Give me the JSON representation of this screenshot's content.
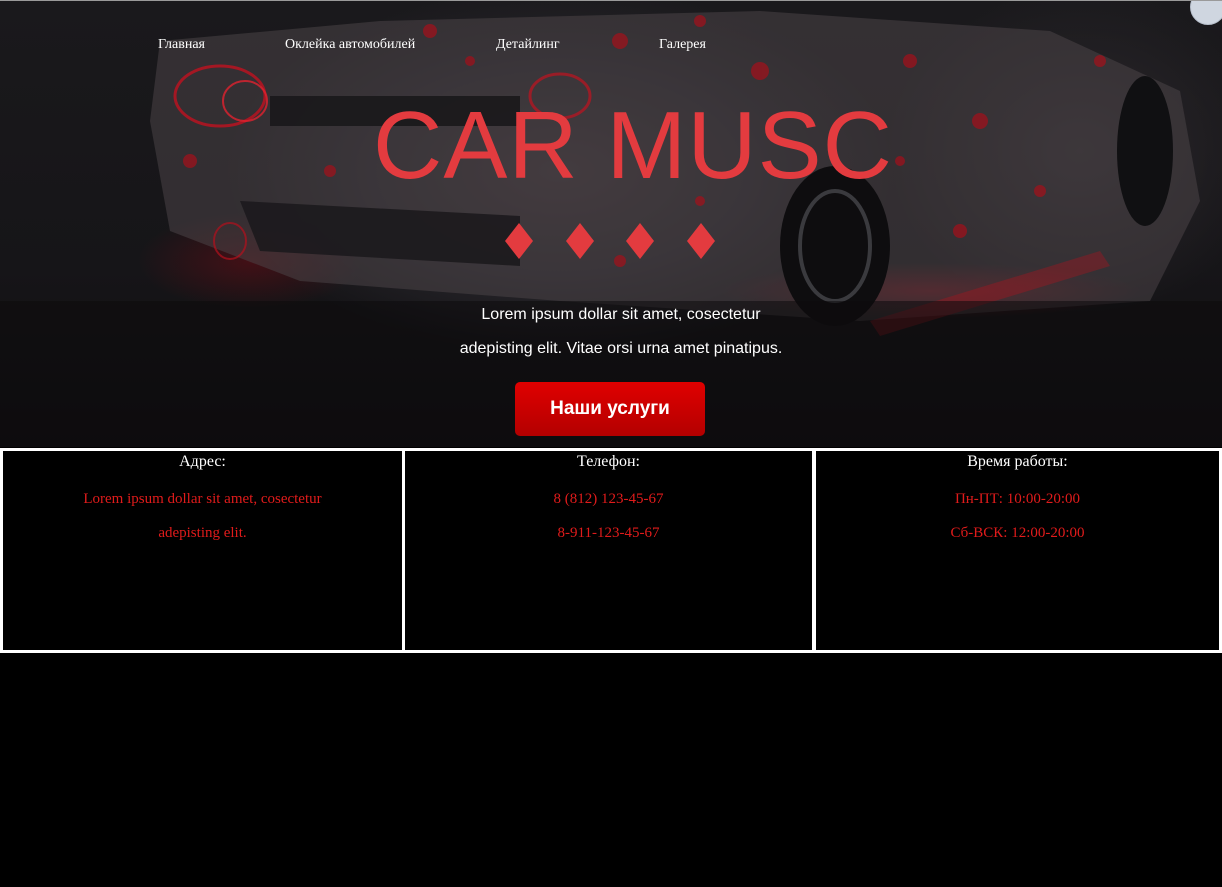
{
  "nav": {
    "items": [
      "Главная",
      "Оклейка автомобилей",
      "Детайлинг",
      "Галерея"
    ]
  },
  "hero": {
    "title": "CAR MUSC",
    "decor_symbol": "diamond",
    "decor_count": 4,
    "text_line1": "Lorem ipsum dollar sit amet, cosectetur",
    "text_line2": "adepisting elit. Vitae orsi urna amet pinatipus.",
    "cta_label": "Наши услуги"
  },
  "info": {
    "address": {
      "heading": "Адрес:",
      "line1": "Lorem ipsum dollar sit amet, cosectetur",
      "line2": "adepisting elit."
    },
    "phone": {
      "heading": "Телефон:",
      "line1": "8 (812) 123-45-67",
      "line2": "8-911-123-45-67"
    },
    "hours": {
      "heading": "Время работы:",
      "line1": "Пн-ПТ: 10:00-20:00",
      "line2": "Сб-ВСК: 12:00-20:00"
    }
  },
  "colors": {
    "accent": "#e33b3f",
    "button": "#d00000",
    "info_text": "#e01b1b",
    "background": "#000000"
  }
}
